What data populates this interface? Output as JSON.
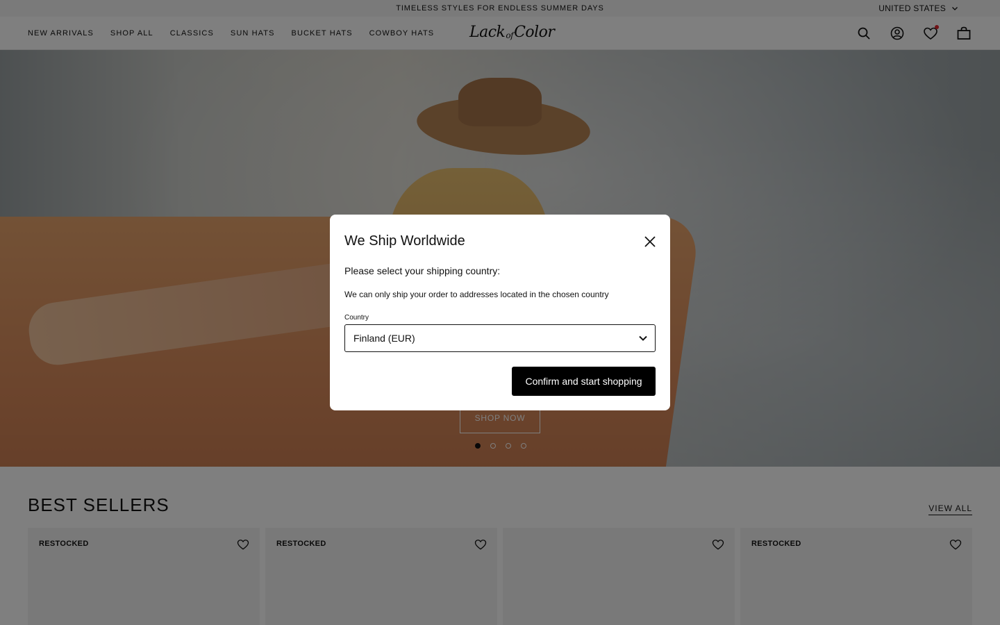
{
  "announcement": {
    "text": "TIMELESS STYLES FOR ENDLESS SUMMER DAYS"
  },
  "region": {
    "label": "UNITED STATES",
    "icon": "chevron-down-icon"
  },
  "nav": {
    "items": [
      {
        "label": "NEW ARRIVALS"
      },
      {
        "label": "SHOP ALL"
      },
      {
        "label": "CLASSICS"
      },
      {
        "label": "SUN HATS"
      },
      {
        "label": "BUCKET HATS"
      },
      {
        "label": "COWBOY HATS"
      }
    ]
  },
  "logo": {
    "part1": "Lack",
    "part2": "of",
    "part3": "Color"
  },
  "header_icons": [
    "search-icon",
    "account-icon",
    "wishlist-heart-icon",
    "bag-icon"
  ],
  "hero": {
    "cta": "SHOP NOW",
    "slides": 4,
    "active_slide": 1
  },
  "best_sellers": {
    "title": "BEST SELLERS",
    "view_all": "VIEW ALL",
    "cards": [
      {
        "badge": "RESTOCKED"
      },
      {
        "badge": "RESTOCKED"
      },
      {
        "badge": ""
      },
      {
        "badge": "RESTOCKED"
      }
    ]
  },
  "modal": {
    "title": "We Ship Worldwide",
    "subtitle": "Please select your shipping country:",
    "note": "We can only ship your order to addresses located in the chosen country",
    "country_label": "Country",
    "country_value": "Finland (EUR)",
    "confirm_label": "Confirm and start shopping"
  },
  "colors": {
    "overlay": "#00000080",
    "wishlist_dot": "#e0262e",
    "button": "#000000"
  }
}
